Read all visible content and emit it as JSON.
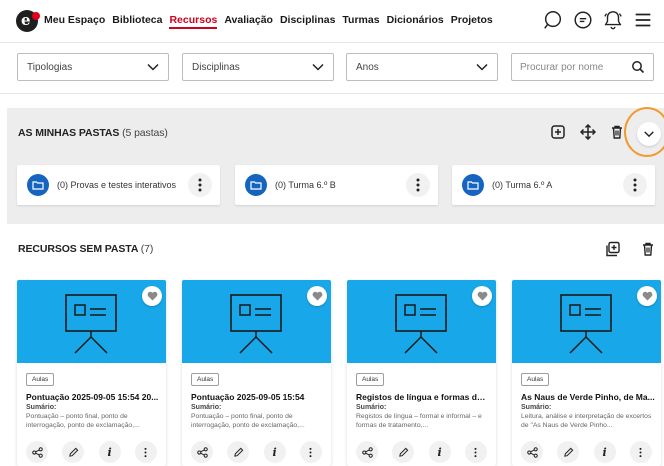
{
  "brand": {
    "logo_letter": "e"
  },
  "nav": {
    "items": [
      {
        "label": "Meu Espaço",
        "active": false
      },
      {
        "label": "Biblioteca",
        "active": false
      },
      {
        "label": "Recursos",
        "active": true
      },
      {
        "label": "Avaliação",
        "active": false
      },
      {
        "label": "Disciplinas",
        "active": false
      },
      {
        "label": "Turmas",
        "active": false
      },
      {
        "label": "Dicionários",
        "active": false
      },
      {
        "label": "Projetos",
        "active": false
      }
    ],
    "icons": [
      "search-icon",
      "chat-icon",
      "notifications-icon",
      "menu-icon"
    ]
  },
  "filters": {
    "tipologias": "Tipologias",
    "disciplinas": "Disciplinas",
    "anos": "Anos",
    "search_placeholder": "Procurar por nome"
  },
  "folders": {
    "title": "AS MINHAS PASTAS",
    "count": "(5 pastas)",
    "items": [
      {
        "label": "(0) Provas e testes interativos"
      },
      {
        "label": "(0) Turma 6.º B"
      },
      {
        "label": "(0) Turma 6.º A"
      }
    ]
  },
  "resources": {
    "title": "RECURSOS SEM PASTA",
    "count": "(7)",
    "items": [
      {
        "tag": "Aulas",
        "title": "Pontuação 2025-09-05 15:54 20...",
        "sub": "Sumário:",
        "desc": "Pontuação – ponto final, ponto de interrogação, ponto de exclamação,..."
      },
      {
        "tag": "Aulas",
        "title": "Pontuação 2025-09-05 15:54",
        "sub": "Sumário:",
        "desc": "Pontuação – ponto final, ponto de interrogação, ponto de exclamação,..."
      },
      {
        "tag": "Aulas",
        "title": "Registos de língua e formas de ...",
        "sub": "Sumário:",
        "desc": "Registos de língua – formal e informal – e formas de tratamento,..."
      },
      {
        "tag": "Aulas",
        "title": "As Naus de Verde Pinho, de Ma...",
        "sub": "Sumário:",
        "desc": "Leitura, análise e interpretação de excertos de \"As Naus de Verde Pinho..."
      }
    ]
  },
  "colors": {
    "accent_red": "#d0021b",
    "thumb_blue": "#18a7e8",
    "folder_blue": "#1565c0",
    "highlight_orange": "#f29a2e"
  }
}
